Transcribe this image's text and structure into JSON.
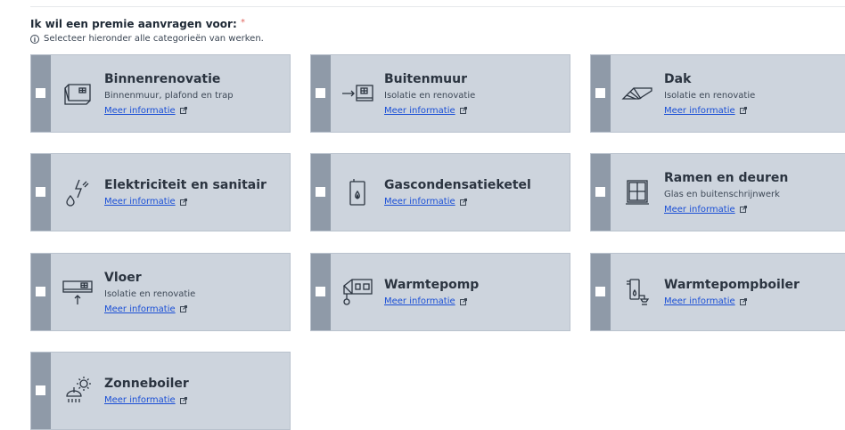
{
  "form": {
    "question": "Ik wil een premie aanvragen voor:",
    "required_mark": "*",
    "hint": "Selecteer hieronder alle categorieën van werken."
  },
  "link_label": "Meer informatie",
  "cards": [
    {
      "title": "Binnenrenovatie",
      "subtitle": "Binnenmuur, plafond en trap",
      "icon": "interior-wall-icon"
    },
    {
      "title": "Buitenmuur",
      "subtitle": "Isolatie en renovatie",
      "icon": "exterior-wall-icon"
    },
    {
      "title": "Dak",
      "subtitle": "Isolatie en renovatie",
      "icon": "roof-icon"
    },
    {
      "title": "Elektriciteit en sanitair",
      "subtitle": "",
      "icon": "electricity-water-icon"
    },
    {
      "title": "Gascondensatieketel",
      "subtitle": "",
      "icon": "gas-boiler-icon"
    },
    {
      "title": "Ramen en deuren",
      "subtitle": "Glas en buitenschrijnwerk",
      "icon": "window-icon"
    },
    {
      "title": "Vloer",
      "subtitle": "Isolatie en renovatie",
      "icon": "floor-icon"
    },
    {
      "title": "Warmtepomp",
      "subtitle": "",
      "icon": "heat-pump-icon"
    },
    {
      "title": "Warmtepompboiler",
      "subtitle": "",
      "icon": "heat-pump-boiler-icon"
    },
    {
      "title": "Zonneboiler",
      "subtitle": "",
      "icon": "solar-boiler-icon"
    }
  ],
  "colors": {
    "card_bg": "#cdd4dd",
    "card_bar": "#8f9aa8",
    "link": "#1a4fd6",
    "required": "#e0665f"
  }
}
